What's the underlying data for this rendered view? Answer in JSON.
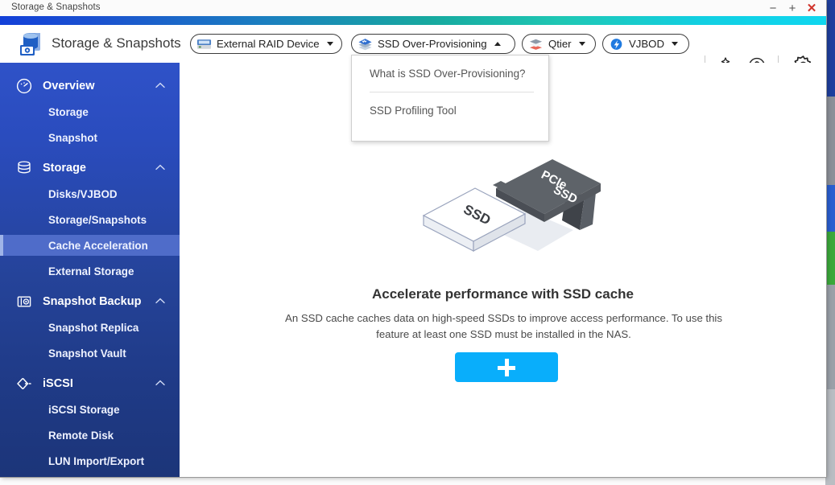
{
  "window": {
    "title": "Storage & Snapshots",
    "controls": {
      "minimize": "−",
      "maximize": "+",
      "close": "✕"
    }
  },
  "header": {
    "app_title": "Storage & Snapshots",
    "logo_icon": "storage-snapshots-icon",
    "pills": [
      {
        "id": "external-raid-device",
        "label": "External RAID Device",
        "icon": "raid-enclosure-icon",
        "caret": "down"
      },
      {
        "id": "ssd-over-provisioning",
        "label": "SSD Over-Provisioning",
        "icon": "ssd-stack-icon",
        "caret": "up"
      },
      {
        "id": "qtier",
        "label": "Qtier",
        "icon": "qtier-layers-icon",
        "caret": "down"
      },
      {
        "id": "vjbod",
        "label": "VJBOD",
        "icon": "vjbod-icon",
        "caret": "down"
      }
    ],
    "tools": [
      {
        "id": "magic-wand",
        "icon": "magic-wand-icon"
      },
      {
        "id": "help",
        "icon": "help-circle-icon"
      },
      {
        "id": "settings",
        "icon": "gear-icon"
      }
    ]
  },
  "dropdown": {
    "open": true,
    "owner": "ssd-over-provisioning",
    "items": [
      {
        "id": "what-is-ssd-over-provisioning",
        "label": "What is SSD Over-Provisioning?"
      },
      {
        "id": "ssd-profiling-tool",
        "label": "SSD Profiling Tool"
      }
    ]
  },
  "sidebar": {
    "selected": "Cache Acceleration",
    "groups": [
      {
        "id": "overview",
        "label": "Overview",
        "icon": "gauge-icon",
        "expanded": true,
        "items": [
          {
            "id": "storage",
            "label": "Storage"
          },
          {
            "id": "snapshot",
            "label": "Snapshot"
          }
        ]
      },
      {
        "id": "storage",
        "label": "Storage",
        "icon": "database-icon",
        "expanded": true,
        "items": [
          {
            "id": "disks-vjbod",
            "label": "Disks/VJBOD"
          },
          {
            "id": "storage-snapshots",
            "label": "Storage/Snapshots"
          },
          {
            "id": "cache-acceleration",
            "label": "Cache Acceleration"
          },
          {
            "id": "external-storage",
            "label": "External Storage"
          }
        ]
      },
      {
        "id": "snapshot-backup",
        "label": "Snapshot Backup",
        "icon": "snapshot-camera-icon",
        "expanded": true,
        "items": [
          {
            "id": "snapshot-replica",
            "label": "Snapshot Replica"
          },
          {
            "id": "snapshot-vault",
            "label": "Snapshot Vault"
          }
        ]
      },
      {
        "id": "iscsi",
        "label": "iSCSI",
        "icon": "iscsi-arrow-icon",
        "expanded": true,
        "items": [
          {
            "id": "iscsi-storage",
            "label": "iSCSI Storage"
          },
          {
            "id": "remote-disk",
            "label": "Remote Disk"
          },
          {
            "id": "lun-import-export",
            "label": "LUN Import/Export"
          }
        ]
      }
    ]
  },
  "content": {
    "illustration": {
      "name": "ssd-and-pcie-ssd-illustration",
      "labels": {
        "ssd": "SSD",
        "pcie": "PCIe",
        "pcie2": "SSD"
      }
    },
    "title": "Accelerate performance with SSD cache",
    "description": "An SSD cache caches data on high-speed SSDs to improve access performance. To use this feature at least one SSD must be installed in the NAS.",
    "add_button": {
      "icon": "plus-icon",
      "label": ""
    }
  },
  "colors": {
    "accent_gradient_start": "#1340d8",
    "accent_gradient_end": "#0fd6ef",
    "sidebar_top": "#2f52c8",
    "sidebar_bottom": "#1c3579",
    "sidebar_selected": "#4f6cc9",
    "add_button": "#09aefb",
    "close_red": "#d0342c"
  }
}
